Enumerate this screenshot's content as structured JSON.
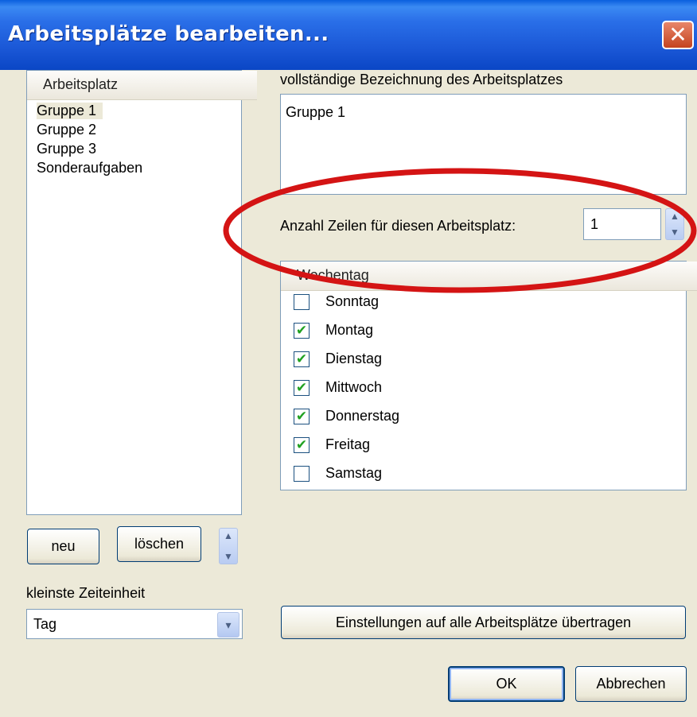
{
  "window": {
    "title": "Arbeitsplätze bearbeiten...",
    "close_glyph": "✕"
  },
  "workplace_list": {
    "header": "Arbeitsplatz",
    "items": [
      "Gruppe 1",
      "Gruppe 2",
      "Gruppe 3",
      "Sonderaufgaben"
    ],
    "selected_index": 0
  },
  "list_buttons": {
    "new_label": "neu",
    "delete_label": "löschen"
  },
  "time_unit": {
    "label": "kleinste Zeiteinheit",
    "value": "Tag"
  },
  "full_name": {
    "label": "vollständige Bezeichnung des Arbeitsplatzes",
    "value": "Gruppe 1"
  },
  "rows": {
    "label": "Anzahl Zeilen für diesen Arbeitsplatz:",
    "value": "1"
  },
  "weekdays": {
    "header": "Wochentag",
    "days": [
      {
        "label": "Sonntag",
        "checked": false
      },
      {
        "label": "Montag",
        "checked": true
      },
      {
        "label": "Dienstag",
        "checked": true
      },
      {
        "label": "Mittwoch",
        "checked": true
      },
      {
        "label": "Donnerstag",
        "checked": true
      },
      {
        "label": "Freitag",
        "checked": true
      },
      {
        "label": "Samstag",
        "checked": false
      }
    ]
  },
  "footer": {
    "apply_all_label": "Einstellungen auf alle Arbeitsplätze übertragen",
    "ok_label": "OK",
    "cancel_label": "Abbrechen"
  },
  "icons": {
    "check_glyph": "✔",
    "up_glyph": "▲",
    "down_glyph": "▼",
    "combo_glyph": "▾"
  },
  "colors": {
    "titlebar": "#1a57d6",
    "highlight_ellipse": "#d41414",
    "check": "#21a121",
    "dialog_bg": "#ece9d8"
  }
}
